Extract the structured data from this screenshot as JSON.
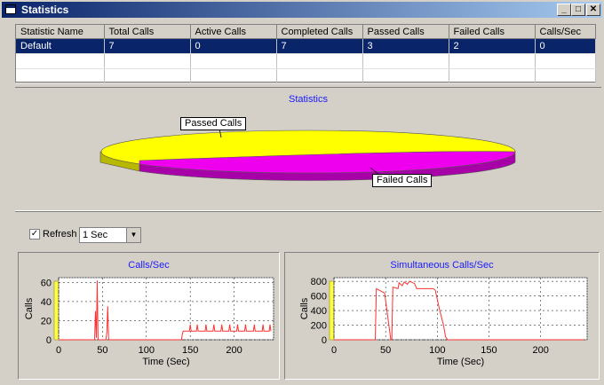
{
  "window": {
    "title": "Statistics"
  },
  "grid": {
    "columns": [
      "Statistic Name",
      "Total Calls",
      "Active Calls",
      "Completed Calls",
      "Passed Calls",
      "Failed Calls",
      "Calls/Sec"
    ],
    "rows": [
      [
        "Default",
        "7",
        "0",
        "7",
        "3",
        "2",
        "0"
      ]
    ]
  },
  "pie": {
    "title": "Statistics",
    "slices": [
      {
        "name": "Passed Calls",
        "value": 3,
        "color": "#ffff00"
      },
      {
        "name": "Failed Calls",
        "value": 2,
        "color": "#ee00ee"
      }
    ]
  },
  "refresh": {
    "checked": true,
    "label": "Refresh",
    "interval": "1 Sec"
  },
  "chart_data": [
    {
      "type": "line",
      "title": "Calls/Sec",
      "xlabel": "Time (Sec)",
      "ylabel": "Calls",
      "xlim": [
        0,
        245
      ],
      "ylim": [
        0,
        65
      ],
      "xticks": [
        0,
        50,
        100,
        150,
        200
      ],
      "yticks": [
        0,
        20,
        40,
        60
      ],
      "color": "#ff3030",
      "points": [
        [
          0,
          0
        ],
        [
          41,
          0
        ],
        [
          42,
          30
        ],
        [
          43,
          2
        ],
        [
          44,
          62
        ],
        [
          45,
          0
        ],
        [
          54,
          0
        ],
        [
          55,
          8
        ],
        [
          56,
          35
        ],
        [
          57,
          0
        ],
        [
          140,
          0
        ],
        [
          141,
          6
        ],
        [
          142,
          9
        ],
        [
          242,
          9
        ],
        [
          149,
          9
        ],
        [
          150,
          16
        ],
        [
          151,
          9
        ],
        [
          157,
          9
        ],
        [
          158,
          16
        ],
        [
          159,
          9
        ],
        [
          167,
          9
        ],
        [
          168,
          16
        ],
        [
          169,
          9
        ],
        [
          176,
          9
        ],
        [
          177,
          16
        ],
        [
          178,
          9
        ],
        [
          185,
          9
        ],
        [
          186,
          16
        ],
        [
          187,
          9
        ],
        [
          194,
          9
        ],
        [
          195,
          16
        ],
        [
          196,
          9
        ],
        [
          203,
          9
        ],
        [
          204,
          16
        ],
        [
          205,
          9
        ],
        [
          212,
          9
        ],
        [
          213,
          16
        ],
        [
          214,
          9
        ],
        [
          222,
          9
        ],
        [
          223,
          16
        ],
        [
          224,
          9
        ],
        [
          232,
          9
        ],
        [
          233,
          16
        ],
        [
          234,
          9
        ],
        [
          240,
          9
        ],
        [
          241,
          16
        ],
        [
          242,
          9
        ]
      ]
    },
    {
      "type": "line",
      "title": "Simultaneous Calls/Sec",
      "xlabel": "Time (Sec)",
      "ylabel": "Calls",
      "xlim": [
        0,
        245
      ],
      "ylim": [
        0,
        850
      ],
      "xticks": [
        0,
        50,
        100,
        150,
        200
      ],
      "yticks": [
        0,
        200,
        400,
        600,
        800
      ],
      "color": "#ff3030",
      "points": [
        [
          0,
          0
        ],
        [
          40,
          0
        ],
        [
          41,
          700
        ],
        [
          49,
          640
        ],
        [
          55,
          0
        ],
        [
          56,
          0
        ],
        [
          57,
          720
        ],
        [
          62,
          700
        ],
        [
          63,
          780
        ],
        [
          66,
          740
        ],
        [
          68,
          790
        ],
        [
          71,
          760
        ],
        [
          73,
          800
        ],
        [
          78,
          770
        ],
        [
          80,
          700
        ],
        [
          96,
          700
        ],
        [
          98,
          680
        ],
        [
          102,
          420
        ],
        [
          106,
          200
        ],
        [
          108,
          40
        ],
        [
          110,
          0
        ],
        [
          242,
          0
        ]
      ]
    }
  ]
}
